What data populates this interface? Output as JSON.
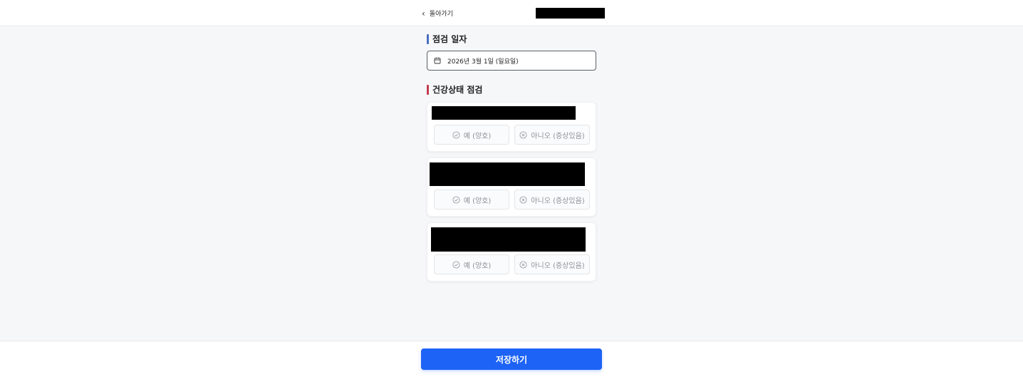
{
  "header": {
    "back_label": "돌아가기"
  },
  "date_section": {
    "title": "점검 일자",
    "date_value": "2026년 3월 1일 (일요일)"
  },
  "health_section": {
    "title": "건강상태 점검",
    "questions": [
      {
        "yes_label": "예 (양호)",
        "no_label": "아니오 (증상있음)"
      },
      {
        "yes_label": "예 (양호)",
        "no_label": "아니오 (증상있음)"
      },
      {
        "yes_label": "예 (양호)",
        "no_label": "아니오 (증상있음)"
      }
    ]
  },
  "footer": {
    "save_label": "저장하기"
  },
  "colors": {
    "primary": "#1d63f5",
    "date_bar": "#4a6fbf",
    "health_bar": "#c23b4f",
    "option_text": "#8c9096"
  },
  "icons": {
    "back": "chevron-left-icon",
    "date": "calendar-icon",
    "yes": "check-circle-icon",
    "no": "x-circle-icon"
  }
}
